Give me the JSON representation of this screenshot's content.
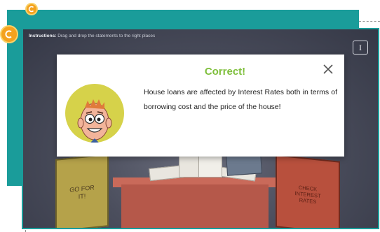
{
  "instructions": {
    "label": "Instructions:",
    "text": "Drag and drop the statements to the right places"
  },
  "info_button": {
    "label": "I"
  },
  "popup": {
    "title": "Correct!",
    "message": "House loans are affected by Interest Rates both in terms of borrowing cost and the price of the house!"
  },
  "books": {
    "left": "GO FOR IT!",
    "right": "CHECK INTEREST RATES"
  },
  "icons": {
    "coin": "coin-icon",
    "close": "close-icon",
    "info": "info-icon",
    "avatar": "cartoon-man-avatar"
  },
  "colors": {
    "teal": "#1a9c9a",
    "coin": "#f4a21f",
    "correct_green": "#7fbf3c",
    "stage": "#3f4353"
  }
}
